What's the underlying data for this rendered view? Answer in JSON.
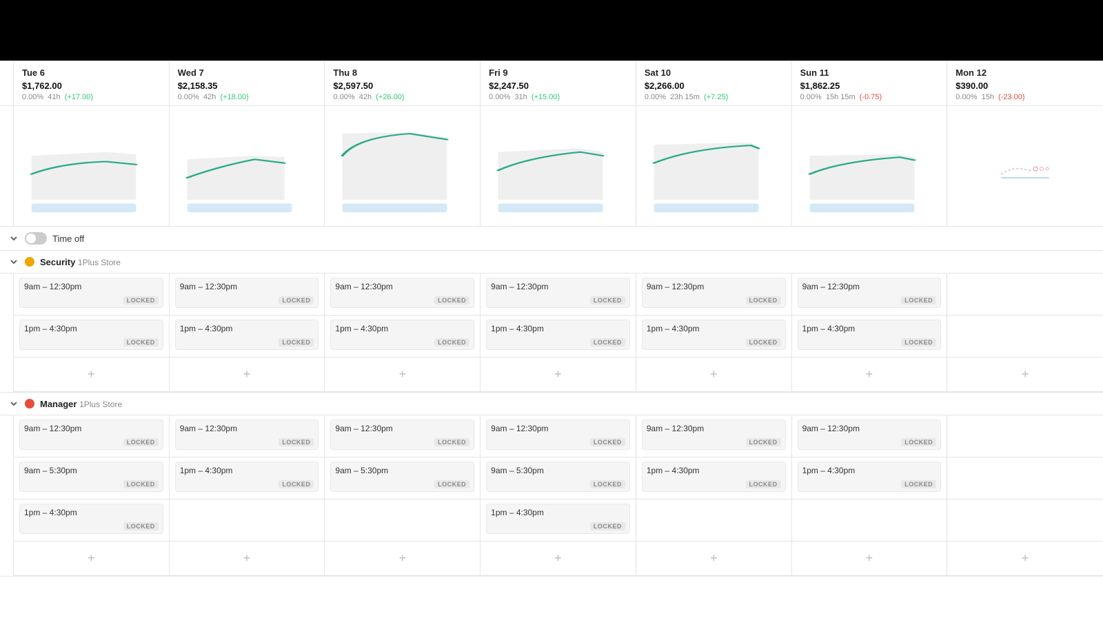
{
  "topBar": {
    "height": 88
  },
  "days": [
    {
      "name": "Tue 6",
      "amount": "$1,762.00",
      "pct": "0.00%",
      "hours": "41h",
      "delta": "+17.00",
      "deltaPositive": true
    },
    {
      "name": "Wed 7",
      "amount": "$2,158.35",
      "pct": "0.00%",
      "hours": "42h",
      "delta": "+18.00",
      "deltaPositive": true
    },
    {
      "name": "Thu 8",
      "amount": "$2,597.50",
      "pct": "0.00%",
      "hours": "42h",
      "delta": "+26.00",
      "deltaPositive": true
    },
    {
      "name": "Fri 9",
      "amount": "$2,247.50",
      "pct": "0.00%",
      "hours": "31h",
      "delta": "+15.00",
      "deltaPositive": true
    },
    {
      "name": "Sat 10",
      "amount": "$2,266.00",
      "pct": "0.00%",
      "hours": "23h 15m",
      "delta": "+7.25",
      "deltaPositive": true
    },
    {
      "name": "Sun 11",
      "amount": "$1,862.25",
      "pct": "0.00%",
      "hours": "15h 15m",
      "delta": "-0.75",
      "deltaPositive": false
    },
    {
      "name": "Mon 12",
      "amount": "$390.00",
      "pct": "0.00%",
      "hours": "15h",
      "delta": "-23.00",
      "deltaPositive": false
    }
  ],
  "timeOff": {
    "label": "Time off",
    "enabled": false
  },
  "roles": [
    {
      "name": "Security",
      "store": "1Plus Store",
      "color": "#f0a500",
      "shifts": [
        [
          "9am – 12:30pm",
          "1pm – 4:30pm"
        ],
        [
          "9am – 12:30pm",
          "1pm – 4:30pm"
        ],
        [
          "9am – 12:30pm",
          "1pm – 4:30pm"
        ],
        [
          "9am – 12:30pm",
          "1pm – 4:30pm"
        ],
        [
          "9am – 12:30pm",
          "1pm – 4:30pm"
        ],
        [
          "9am – 12:30pm",
          "1pm – 4:30pm"
        ],
        []
      ]
    },
    {
      "name": "Manager",
      "store": "1Plus Store",
      "color": "#e74c3c",
      "shifts": [
        [
          "9am – 12:30pm",
          "9am – 5:30pm",
          "1pm – 4:30pm"
        ],
        [
          "9am – 12:30pm",
          "1pm – 4:30pm"
        ],
        [
          "9am – 12:30pm",
          "9am – 5:30pm"
        ],
        [
          "9am – 12:30pm",
          "9am – 5:30pm",
          "1pm – 4:30pm"
        ],
        [
          "9am – 12:30pm",
          "1pm – 4:30pm"
        ],
        [
          "9am – 12:30pm",
          "1pm – 4:30pm"
        ],
        []
      ]
    }
  ],
  "labels": {
    "locked": "LOCKED",
    "addShift": "+"
  }
}
